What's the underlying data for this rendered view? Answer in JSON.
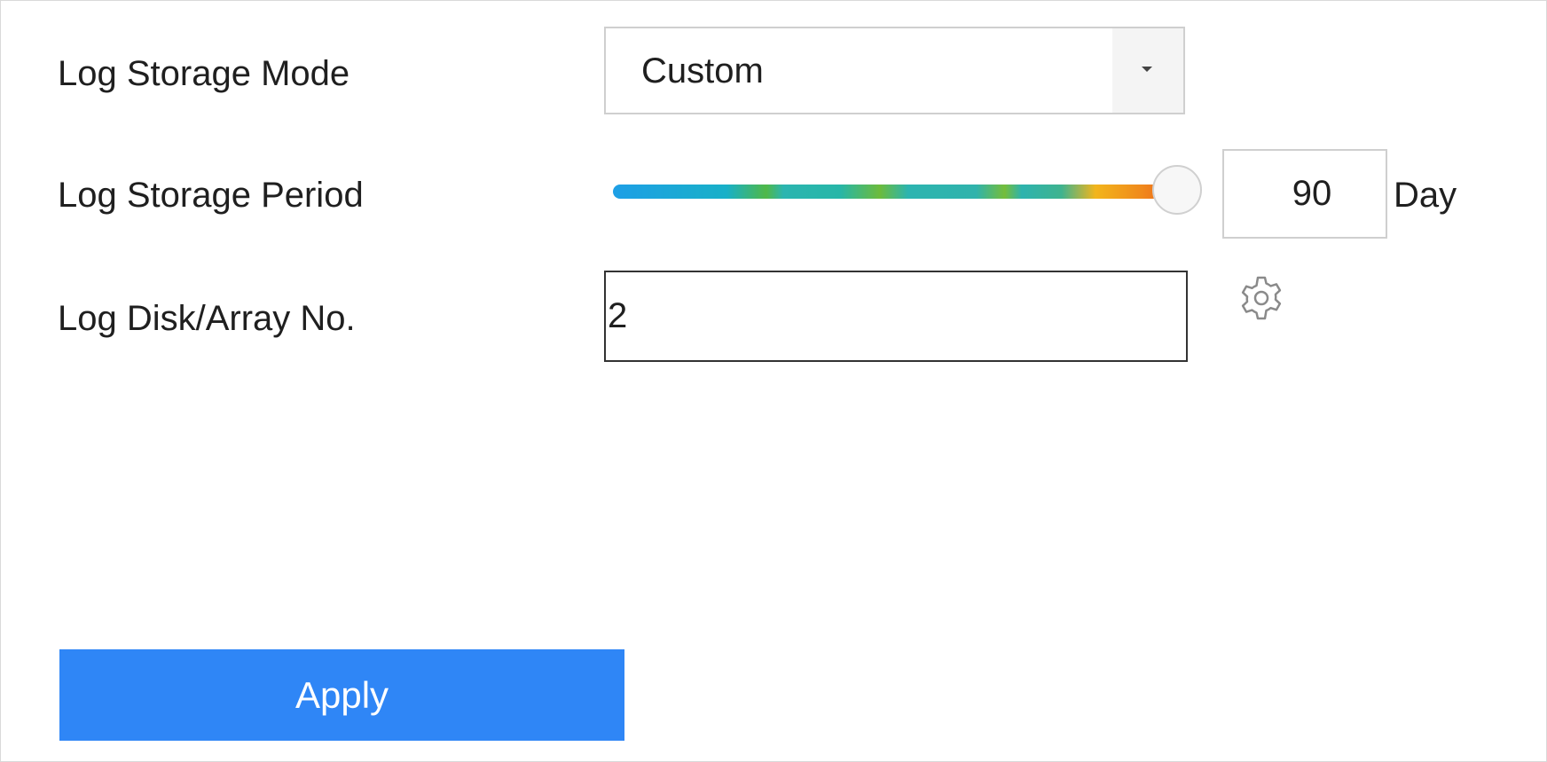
{
  "form": {
    "mode": {
      "label": "Log Storage Mode",
      "value": "Custom"
    },
    "period": {
      "label": "Log Storage Period",
      "value": "90",
      "unit": "Day",
      "slider_fraction": 1.0
    },
    "disk": {
      "label": "Log Disk/Array No.",
      "value": "2"
    }
  },
  "icons": {
    "dropdown": "chevron-down-icon",
    "settings": "gear-icon"
  },
  "actions": {
    "apply_label": "Apply"
  },
  "colors": {
    "primary": "#2f86f6",
    "input_border": "#cfcfcf",
    "focused_border": "#333333"
  }
}
